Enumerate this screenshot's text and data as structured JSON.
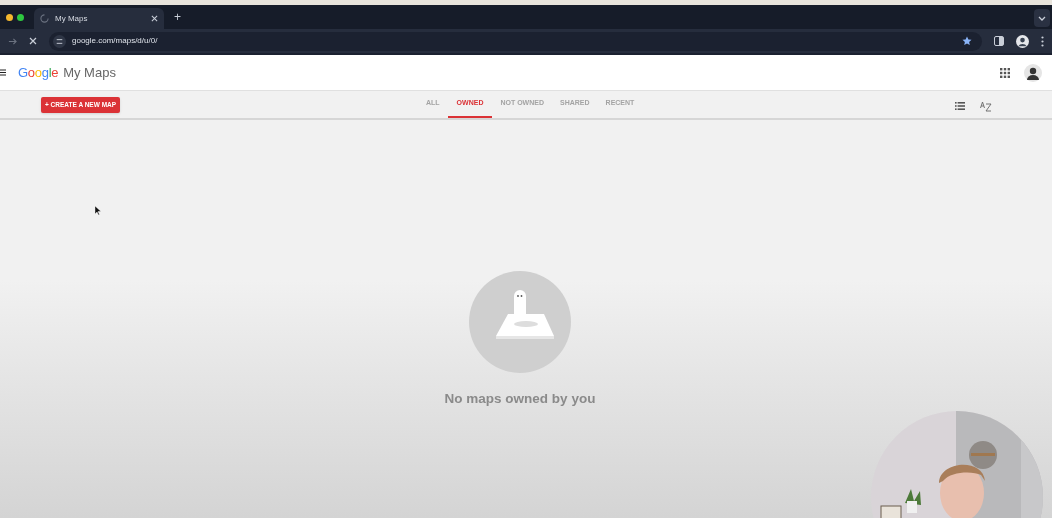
{
  "browser": {
    "tab_title": "My Maps",
    "new_tab": "+",
    "url": "google.com/maps/d/u/0/"
  },
  "header": {
    "logo": "Google",
    "product": "My Maps"
  },
  "toolbar": {
    "create_button": "+ CREATE A NEW MAP",
    "tabs": [
      {
        "label": "ALL",
        "selected": false
      },
      {
        "label": "OWNED",
        "selected": true
      },
      {
        "label": "NOT OWNED",
        "selected": false
      },
      {
        "label": "SHARED",
        "selected": false
      },
      {
        "label": "RECENT",
        "selected": false
      }
    ]
  },
  "empty_state": {
    "message": "No maps owned by you"
  }
}
